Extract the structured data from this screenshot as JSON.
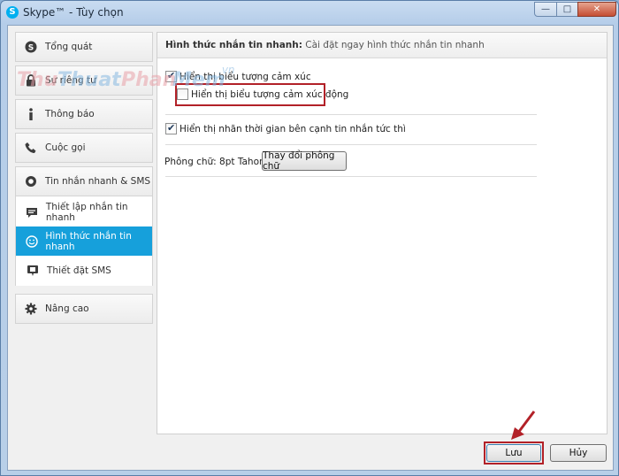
{
  "window": {
    "title": "Skype™ - Tùy chọn",
    "buttons": {
      "minimize": "—",
      "maximize": "□",
      "close": "✕"
    }
  },
  "sidebar": {
    "items": [
      {
        "label": "Tổng quát",
        "icon": "skype-icon"
      },
      {
        "label": "Sự riêng tư",
        "icon": "lock-icon"
      },
      {
        "label": "Thông báo",
        "icon": "info-icon"
      },
      {
        "label": "Cuộc gọi",
        "icon": "phone-icon"
      }
    ],
    "group": {
      "label": "Tin nhắn nhanh & SMS",
      "icon": "chat-icon",
      "children": [
        {
          "label": "Thiết lập nhắn tin nhanh",
          "icon": "speech-bubble-icon"
        },
        {
          "label": "Hình thức nhắn tin nhanh",
          "icon": "smiley-icon",
          "active": true
        },
        {
          "label": "Thiết đặt SMS",
          "icon": "sms-icon"
        }
      ]
    },
    "advanced": {
      "label": "Nâng cao",
      "icon": "gear-icon"
    }
  },
  "main": {
    "header_bold": "Hình thức nhắn tin nhanh:",
    "header_text": " Cài đặt ngay hình thức nhắn tin nhanh",
    "options": [
      {
        "label": "Hiển thị biểu tượng cảm xúc",
        "checked": true
      },
      {
        "label": "Hiển thị biểu tượng cảm xúc động",
        "checked": false
      },
      {
        "label": "Hiển thị nhãn thời gian bên cạnh tin nhắn tức thì",
        "checked": true
      }
    ],
    "font_label": "Phông chữ: 8pt Tahoma",
    "font_button": "Thay đổi phông chữ"
  },
  "footer": {
    "save": "Lưu",
    "cancel": "Hủy"
  },
  "watermark": "ThuThuatPhanMem.vn",
  "colors": {
    "active": "#16a0db",
    "highlight": "#b22128",
    "skype": "#00aff0"
  }
}
